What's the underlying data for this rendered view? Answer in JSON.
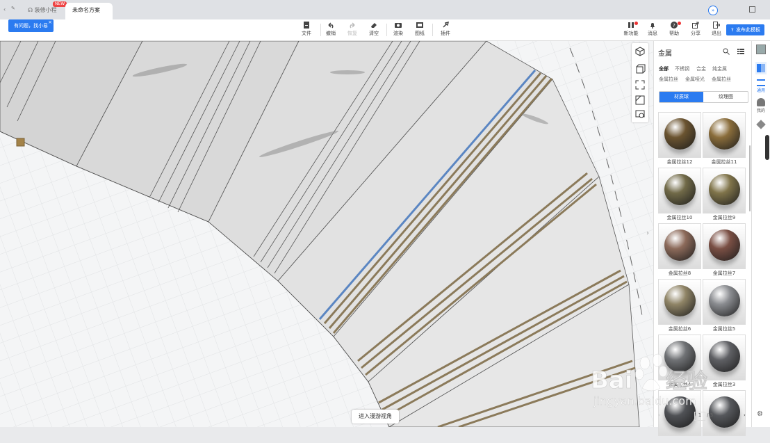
{
  "tabs": {
    "home": "装修小程",
    "home_badge": "NEW",
    "active": "未命名方案"
  },
  "helptip": "有问题，找小易",
  "toolbar": {
    "file": "文件",
    "undo": "撤销",
    "redo": "恢复",
    "clear": "清空",
    "render": "渲染",
    "drawing": "图纸",
    "plugin": "插件",
    "new_features": "新功能",
    "messages": "消息",
    "help": "帮助",
    "share": "分享",
    "exit": "退出",
    "publish": "发布此模板"
  },
  "panel": {
    "title": "金属",
    "filters": [
      "全部",
      "不锈钢",
      "合金",
      "纯金属"
    ],
    "subfilters": [
      "金属拉丝",
      "金属哑光",
      "金属拉丝"
    ],
    "tab_ball": "材质球",
    "tab_texture": "纹理图",
    "materials": [
      {
        "name": "金属拉丝12",
        "color": "#6b5430"
      },
      {
        "name": "金属拉丝11",
        "color": "#8a6d3b"
      },
      {
        "name": "金属拉丝10",
        "color": "#716a48"
      },
      {
        "name": "金属拉丝9",
        "color": "#80744a"
      },
      {
        "name": "金属拉丝8",
        "color": "#8c6a5a"
      },
      {
        "name": "金属拉丝7",
        "color": "#7a4f44"
      },
      {
        "name": "金属拉丝6",
        "color": "#8f8466"
      },
      {
        "name": "金属拉丝5",
        "color": "#8a8c90"
      },
      {
        "name": "金属拉丝4",
        "color": "#707275"
      },
      {
        "name": "金属拉丝3",
        "color": "#5f6064"
      },
      {
        "name": "",
        "color": "#505256"
      },
      {
        "name": "",
        "color": "#56585c"
      }
    ],
    "page_current": "1",
    "page_total": "/ 3"
  },
  "rail": {
    "common": "通用",
    "mine": "我的"
  },
  "canvas": {
    "tour_button": "进入漫游视角"
  },
  "colors": {
    "accent": "#2b7bf0",
    "highlight_line": "#5b86c2",
    "bronze_strip": "#8b7a5a"
  }
}
